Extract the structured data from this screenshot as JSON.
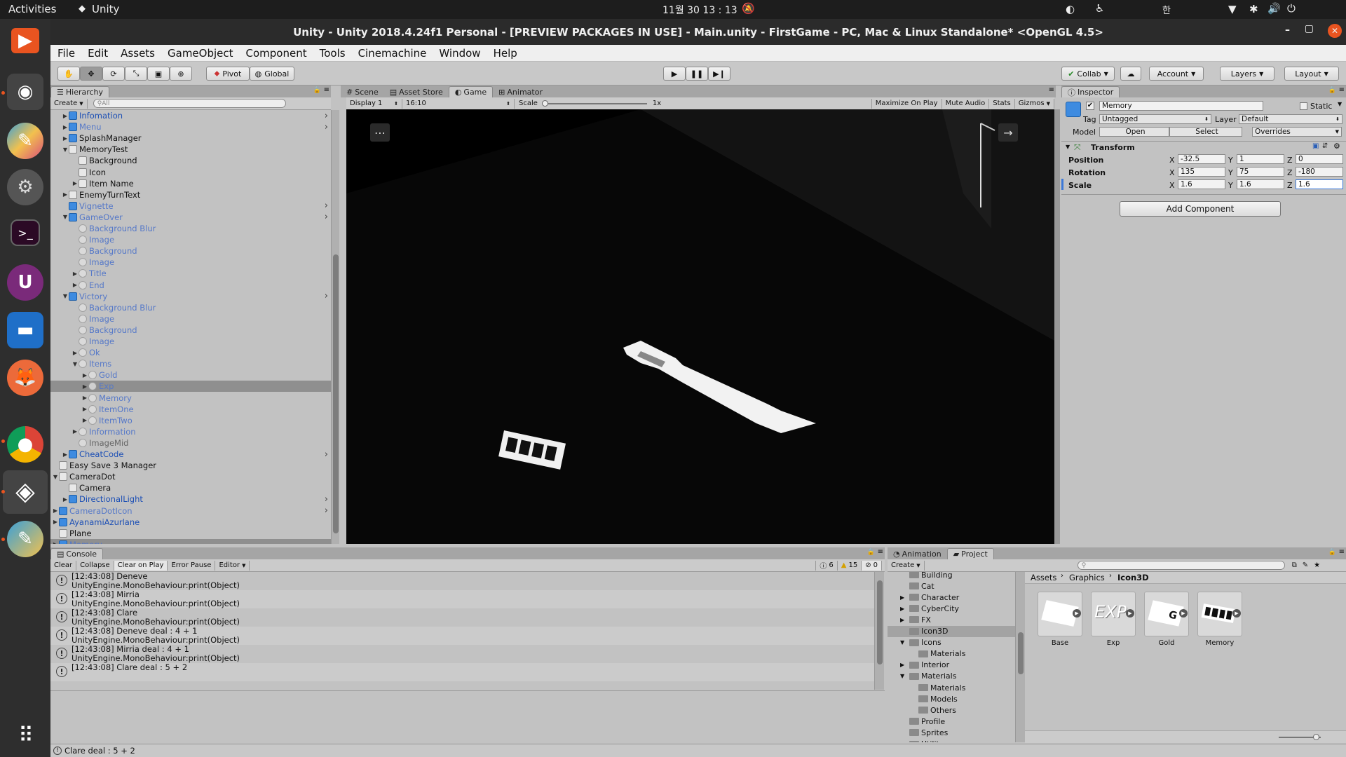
{
  "gnome": {
    "activities": "Activities",
    "app_name": "Unity",
    "clock": "11월 30 13 : 13",
    "input_method": "한"
  },
  "window": {
    "title": "Unity - Unity 2018.4.24f1 Personal - [PREVIEW PACKAGES IN USE] - Main.unity - FirstGame - PC, Mac & Linux Standalone* <OpenGL 4.5>"
  },
  "menu": [
    "File",
    "Edit",
    "Assets",
    "GameObject",
    "Component",
    "Tools",
    "Cinemachine",
    "Window",
    "Help"
  ],
  "toolbar": {
    "pivot": "Pivot",
    "global": "Global",
    "collab": "Collab",
    "account": "Account",
    "layers": "Layers",
    "layout": "Layout"
  },
  "hierarchy": {
    "tab": "Hierarchy",
    "create": "Create",
    "search_placeholder": "All",
    "items": [
      {
        "label": "Infomation",
        "depth": 2,
        "arrow": "right",
        "icon": "pf",
        "color": "blue",
        "chev": true
      },
      {
        "label": "Menu",
        "depth": 2,
        "arrow": "right",
        "icon": "pf",
        "color": "lblue",
        "chev": true
      },
      {
        "label": "SplashManager",
        "depth": 2,
        "arrow": "right",
        "icon": "pf",
        "color": "black"
      },
      {
        "label": "MemoryTest",
        "depth": 2,
        "arrow": "down",
        "icon": "go",
        "color": "black"
      },
      {
        "label": "Background",
        "depth": 3,
        "arrow": "",
        "icon": "go",
        "color": "black"
      },
      {
        "label": "Icon",
        "depth": 3,
        "arrow": "",
        "icon": "go",
        "color": "black"
      },
      {
        "label": "Item Name",
        "depth": 3,
        "arrow": "right",
        "icon": "go",
        "color": "black"
      },
      {
        "label": "EnemyTurnText",
        "depth": 2,
        "arrow": "right",
        "icon": "go",
        "color": "black"
      },
      {
        "label": "Vignette",
        "depth": 2,
        "arrow": "",
        "icon": "pf",
        "color": "lblue",
        "chev": true
      },
      {
        "label": "GameOver",
        "depth": 2,
        "arrow": "down",
        "icon": "pf",
        "color": "lblue",
        "chev": true
      },
      {
        "label": "Background Blur",
        "depth": 3,
        "arrow": "",
        "icon": "ghost",
        "color": "lblue"
      },
      {
        "label": "Image",
        "depth": 3,
        "arrow": "",
        "icon": "ghost",
        "color": "lblue"
      },
      {
        "label": "Background",
        "depth": 3,
        "arrow": "",
        "icon": "ghost",
        "color": "lblue"
      },
      {
        "label": "Image",
        "depth": 3,
        "arrow": "",
        "icon": "ghost",
        "color": "lblue"
      },
      {
        "label": "Title",
        "depth": 3,
        "arrow": "right",
        "icon": "ghost",
        "color": "lblue"
      },
      {
        "label": "End",
        "depth": 3,
        "arrow": "right",
        "icon": "ghost",
        "color": "lblue"
      },
      {
        "label": "Victory",
        "depth": 2,
        "arrow": "down",
        "icon": "pf",
        "color": "lblue",
        "chev": true
      },
      {
        "label": "Background Blur",
        "depth": 3,
        "arrow": "",
        "icon": "ghost",
        "color": "lblue"
      },
      {
        "label": "Image",
        "depth": 3,
        "arrow": "",
        "icon": "ghost",
        "color": "lblue"
      },
      {
        "label": "Background",
        "depth": 3,
        "arrow": "",
        "icon": "ghost",
        "color": "lblue"
      },
      {
        "label": "Image",
        "depth": 3,
        "arrow": "",
        "icon": "ghost",
        "color": "lblue"
      },
      {
        "label": "Ok",
        "depth": 3,
        "arrow": "right",
        "icon": "ghost",
        "color": "lblue"
      },
      {
        "label": "Items",
        "depth": 3,
        "arrow": "down",
        "icon": "ghost",
        "color": "lblue"
      },
      {
        "label": "Gold",
        "depth": 4,
        "arrow": "right",
        "icon": "ghost",
        "color": "lblue"
      },
      {
        "label": "Exp",
        "depth": 4,
        "arrow": "right",
        "icon": "ghost",
        "color": "lblue",
        "selected": true
      },
      {
        "label": "Memory",
        "depth": 4,
        "arrow": "right",
        "icon": "ghost",
        "color": "lblue"
      },
      {
        "label": "ItemOne",
        "depth": 4,
        "arrow": "right",
        "icon": "ghost",
        "color": "lblue"
      },
      {
        "label": "ItemTwo",
        "depth": 4,
        "arrow": "right",
        "icon": "ghost",
        "color": "lblue"
      },
      {
        "label": "Information",
        "depth": 3,
        "arrow": "right",
        "icon": "ghost",
        "color": "lblue"
      },
      {
        "label": "ImageMid",
        "depth": 3,
        "arrow": "",
        "icon": "ghost",
        "color": "grey"
      },
      {
        "label": "CheatCode",
        "depth": 2,
        "arrow": "right",
        "icon": "pf",
        "color": "blue",
        "chev": true
      },
      {
        "label": "Easy Save 3 Manager",
        "depth": 1,
        "arrow": "",
        "icon": "go",
        "color": "black"
      },
      {
        "label": "CameraDot",
        "depth": 1,
        "arrow": "down",
        "icon": "go",
        "color": "black"
      },
      {
        "label": "Camera",
        "depth": 2,
        "arrow": "",
        "icon": "go",
        "color": "black"
      },
      {
        "label": "DirectionalLight",
        "depth": 2,
        "arrow": "right",
        "icon": "pf",
        "color": "blue",
        "chev": true
      },
      {
        "label": "CameraDotIcon",
        "depth": 1,
        "arrow": "right",
        "icon": "pf",
        "color": "lblue",
        "chev": true
      },
      {
        "label": "AyanamiAzurlane",
        "depth": 1,
        "arrow": "right",
        "icon": "pf",
        "color": "blue"
      },
      {
        "label": "Plane",
        "depth": 1,
        "arrow": "",
        "icon": "go",
        "color": "black"
      },
      {
        "label": "Memory",
        "depth": 1,
        "arrow": "right",
        "icon": "pf",
        "color": "lblue",
        "selected": true
      }
    ]
  },
  "center_tabs": {
    "scene": "Scene",
    "asset_store": "Asset Store",
    "game": "Game",
    "animator": "Animator"
  },
  "game_bar": {
    "display": "Display 1",
    "aspect": "16:10",
    "scale_label": "Scale",
    "scale_value": "1x",
    "scale_fraction": 0.0,
    "maximize": "Maximize On Play",
    "mute": "Mute Audio",
    "stats": "Stats",
    "gizmos": "Gizmos"
  },
  "inspector": {
    "tab": "Inspector",
    "object_name": "Memory",
    "static_label": "Static",
    "tag_label": "Tag",
    "tag_value": "Untagged",
    "layer_label": "Layer",
    "layer_value": "Default",
    "model_label": "Model",
    "open": "Open",
    "select": "Select",
    "overrides": "Overrides",
    "transform_title": "Transform",
    "position_label": "Position",
    "rotation_label": "Rotation",
    "scale_label": "Scale",
    "axis_x": "X",
    "axis_y": "Y",
    "axis_z": "Z",
    "position": {
      "x": "-32.5",
      "y": "1",
      "z": "0"
    },
    "rotation": {
      "x": "135",
      "y": "75",
      "z": "-180"
    },
    "scale": {
      "x": "1.6",
      "y": "1.6",
      "z": "1.6"
    },
    "add_component": "Add Component"
  },
  "console": {
    "tab": "Console",
    "buttons": {
      "clear": "Clear",
      "collapse": "Collapse",
      "clear_on_play": "Clear on Play",
      "error_pause": "Error Pause",
      "editor": "Editor"
    },
    "counts": {
      "info": "6",
      "warn": "15",
      "error": "0"
    },
    "entries": [
      {
        "line1": "[12:43:08] Deneve",
        "line2": "UnityEngine.MonoBehaviour:print(Object)"
      },
      {
        "line1": "[12:43:08] Mirria",
        "line2": "UnityEngine.MonoBehaviour:print(Object)"
      },
      {
        "line1": "[12:43:08] Clare",
        "line2": "UnityEngine.MonoBehaviour:print(Object)"
      },
      {
        "line1": "[12:43:08] Deneve deal : 4 + 1",
        "line2": "UnityEngine.MonoBehaviour:print(Object)"
      },
      {
        "line1": "[12:43:08] Mirria deal : 4 + 1",
        "line2": "UnityEngine.MonoBehaviour:print(Object)"
      },
      {
        "line1": "[12:43:08] Clare deal : 5 + 2",
        "line2": ""
      }
    ]
  },
  "project": {
    "tab_animation": "Animation",
    "tab_project": "Project",
    "create": "Create",
    "breadcrumb": [
      "Assets",
      "Graphics",
      "Icon3D"
    ],
    "folders": [
      {
        "label": "Building",
        "depth": 1,
        "arrow": ""
      },
      {
        "label": "Cat",
        "depth": 1,
        "arrow": ""
      },
      {
        "label": "Character",
        "depth": 1,
        "arrow": "right"
      },
      {
        "label": "CyberCity",
        "depth": 1,
        "arrow": "right"
      },
      {
        "label": "FX",
        "depth": 1,
        "arrow": "right"
      },
      {
        "label": "Icon3D",
        "depth": 1,
        "arrow": "",
        "selected": true
      },
      {
        "label": "Icons",
        "depth": 1,
        "arrow": "down"
      },
      {
        "label": "Materials",
        "depth": 2,
        "arrow": ""
      },
      {
        "label": "Interior",
        "depth": 1,
        "arrow": "right"
      },
      {
        "label": "Materials",
        "depth": 1,
        "arrow": "down"
      },
      {
        "label": "Materials",
        "depth": 2,
        "arrow": ""
      },
      {
        "label": "Models",
        "depth": 2,
        "arrow": ""
      },
      {
        "label": "Others",
        "depth": 2,
        "arrow": ""
      },
      {
        "label": "Profile",
        "depth": 1,
        "arrow": ""
      },
      {
        "label": "Sprites",
        "depth": 1,
        "arrow": ""
      },
      {
        "label": "Utility",
        "depth": 1,
        "arrow": ""
      }
    ],
    "assets": [
      {
        "label": "Base",
        "glyph": ""
      },
      {
        "label": "Exp",
        "glyph": "EXP"
      },
      {
        "label": "Gold",
        "glyph": "G"
      },
      {
        "label": "Memory",
        "glyph": ""
      }
    ]
  },
  "status_bar": {
    "message": "Clare deal : 5 + 2"
  }
}
